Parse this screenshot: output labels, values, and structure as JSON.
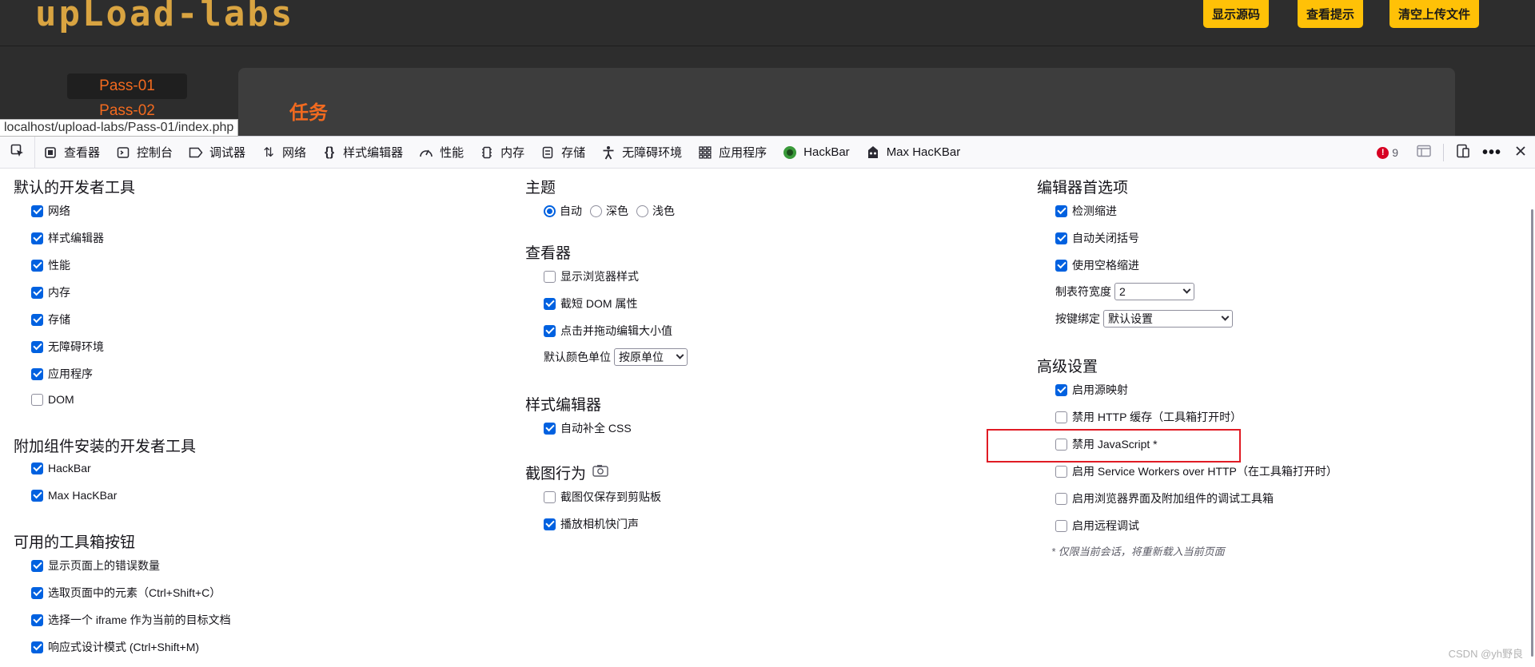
{
  "page": {
    "logo_text": "upLoad-labs",
    "header_buttons": [
      "显示源码",
      "查看提示",
      "清空上传文件"
    ],
    "pass_links": [
      "Pass-01",
      "Pass-02"
    ],
    "task_title": "任务",
    "status_url": "localhost/upload-labs/Pass-01/index.php"
  },
  "toolbar": {
    "tabs": [
      {
        "label": "查看器",
        "icon": "inspector-icon"
      },
      {
        "label": "控制台",
        "icon": "console-icon"
      },
      {
        "label": "调试器",
        "icon": "debugger-icon"
      },
      {
        "label": "网络",
        "icon": "network-icon"
      },
      {
        "label": "样式编辑器",
        "icon": "style-editor-icon"
      },
      {
        "label": "性能",
        "icon": "performance-icon"
      },
      {
        "label": "内存",
        "icon": "memory-icon"
      },
      {
        "label": "存储",
        "icon": "storage-icon"
      },
      {
        "label": "无障碍环境",
        "icon": "accessibility-icon"
      },
      {
        "label": "应用程序",
        "icon": "application-icon"
      },
      {
        "label": "HackBar",
        "icon": "hackbar-icon"
      },
      {
        "label": "Max HacKBar",
        "icon": "max-hackbar-icon"
      }
    ],
    "error_count": "9"
  },
  "settings": {
    "default_tools": {
      "title": "默认的开发者工具",
      "items": [
        {
          "label": "网络",
          "checked": true
        },
        {
          "label": "样式编辑器",
          "checked": true
        },
        {
          "label": "性能",
          "checked": true
        },
        {
          "label": "内存",
          "checked": true
        },
        {
          "label": "存储",
          "checked": true
        },
        {
          "label": "无障碍环境",
          "checked": true
        },
        {
          "label": "应用程序",
          "checked": true
        },
        {
          "label": "DOM",
          "checked": false
        }
      ]
    },
    "addon_tools": {
      "title": "附加组件安装的开发者工具",
      "items": [
        {
          "label": "HackBar",
          "checked": true
        },
        {
          "label": "Max HacKBar",
          "checked": true
        }
      ]
    },
    "toolbox_buttons": {
      "title": "可用的工具箱按钮",
      "items": [
        {
          "label": "显示页面上的错误数量",
          "checked": true
        },
        {
          "label": "选取页面中的元素（Ctrl+Shift+C）",
          "checked": true
        },
        {
          "label": "选择一个 iframe 作为当前的目标文档",
          "checked": true
        },
        {
          "label": "响应式设计模式 (Ctrl+Shift+M)",
          "checked": true
        }
      ]
    },
    "theme": {
      "title": "主题",
      "options": [
        {
          "label": "自动",
          "selected": true
        },
        {
          "label": "深色",
          "selected": false
        },
        {
          "label": "浅色",
          "selected": false
        }
      ]
    },
    "inspector": {
      "title": "查看器",
      "items": [
        {
          "label": "显示浏览器样式",
          "checked": false
        },
        {
          "label": "截短 DOM 属性",
          "checked": true
        },
        {
          "label": "点击并拖动编辑大小值",
          "checked": true
        }
      ],
      "color_unit_label": "默认颜色单位",
      "color_unit_value": "按原单位"
    },
    "style_editor": {
      "title": "样式编辑器",
      "items": [
        {
          "label": "自动补全 CSS",
          "checked": true
        }
      ]
    },
    "screenshot": {
      "title": "截图行为",
      "items": [
        {
          "label": "截图仅保存到剪贴板",
          "checked": false
        },
        {
          "label": "播放相机快门声",
          "checked": true
        }
      ]
    },
    "editor_prefs": {
      "title": "编辑器首选项",
      "items": [
        {
          "label": "检测缩进",
          "checked": true
        },
        {
          "label": "自动关闭括号",
          "checked": true
        },
        {
          "label": "使用空格缩进",
          "checked": true
        }
      ],
      "tab_size_label": "制表符宽度",
      "tab_size_value": "2",
      "keybinding_label": "按键绑定",
      "keybinding_value": "默认设置"
    },
    "advanced": {
      "title": "高级设置",
      "items": [
        {
          "label": "启用源映射",
          "checked": true
        },
        {
          "label": "禁用 HTTP 缓存（工具箱打开时）",
          "checked": false
        },
        {
          "label": "禁用 JavaScript *",
          "checked": false
        },
        {
          "label": "启用 Service Workers over HTTP（在工具箱打开时）",
          "checked": false
        },
        {
          "label": "启用浏览器界面及附加组件的调试工具箱",
          "checked": false
        },
        {
          "label": "启用远程调试",
          "checked": false
        }
      ],
      "note": "* 仅限当前会话，将重新载入当前页面"
    }
  },
  "watermark": "CSDN @yh野良",
  "colors": {
    "accent": "#0061e0",
    "page_bg": "#2d2d2d",
    "button_yellow": "#ffc107",
    "pass_orange": "#f26a1f",
    "highlight_red": "#e01b24"
  }
}
